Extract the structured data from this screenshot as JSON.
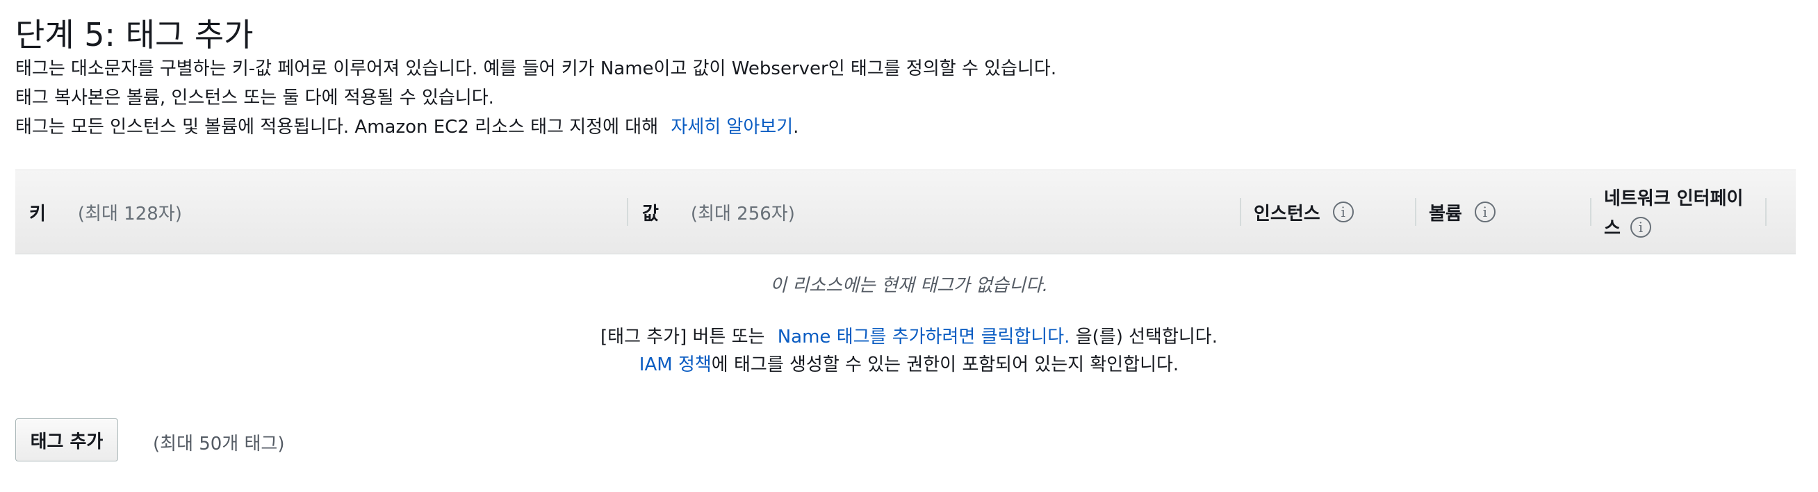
{
  "page": {
    "title": "단계 5: 태그 추가",
    "description": {
      "line1": "태그는 대소문자를 구별하는 키-값 페어로 이루어져 있습니다. 예를 들어 키가 Name이고 값이 Webserver인 태그를 정의할 수 있습니다.",
      "line2": "태그 복사본은 볼륨, 인스턴스 또는 둘 다에 적용될 수 있습니다.",
      "line3_text": "태그는 모든 인스턴스 및 볼륨에 적용됩니다. Amazon EC2 리소스 태그 지정에 대해",
      "line3_link": "자세히 알아보기",
      "line3_suffix": "."
    }
  },
  "table": {
    "columns": {
      "key_label": "키",
      "key_hint": "(최대 128자)",
      "value_label": "값",
      "value_hint": "(최대 256자)",
      "instances_label": "인스턴스",
      "volumes_label": "볼륨",
      "network_label_line1": "네트워크 인터페이",
      "network_label_line2": "스"
    },
    "info_icon_glyph": "i",
    "empty_message": "이 리소스에는 현재 태그가 없습니다.",
    "help": {
      "line1_prefix": "[태그 추가] 버튼 또는",
      "line1_link": "Name 태그를 추가하려면 클릭합니다.",
      "line1_suffix": "을(를) 선택합니다.",
      "line2_link": "IAM 정책",
      "line2_suffix": "에 태그를 생성할 수 있는 권한이 포함되어 있는지 확인합니다."
    }
  },
  "actions": {
    "add_tag_button": "태그 추가",
    "max_tags_hint": "(최대 50개 태그)"
  },
  "colors": {
    "link": "#0a5cc2",
    "text": "#16191f",
    "muted": "#687078"
  },
  "icons": {
    "info": "info-icon"
  }
}
